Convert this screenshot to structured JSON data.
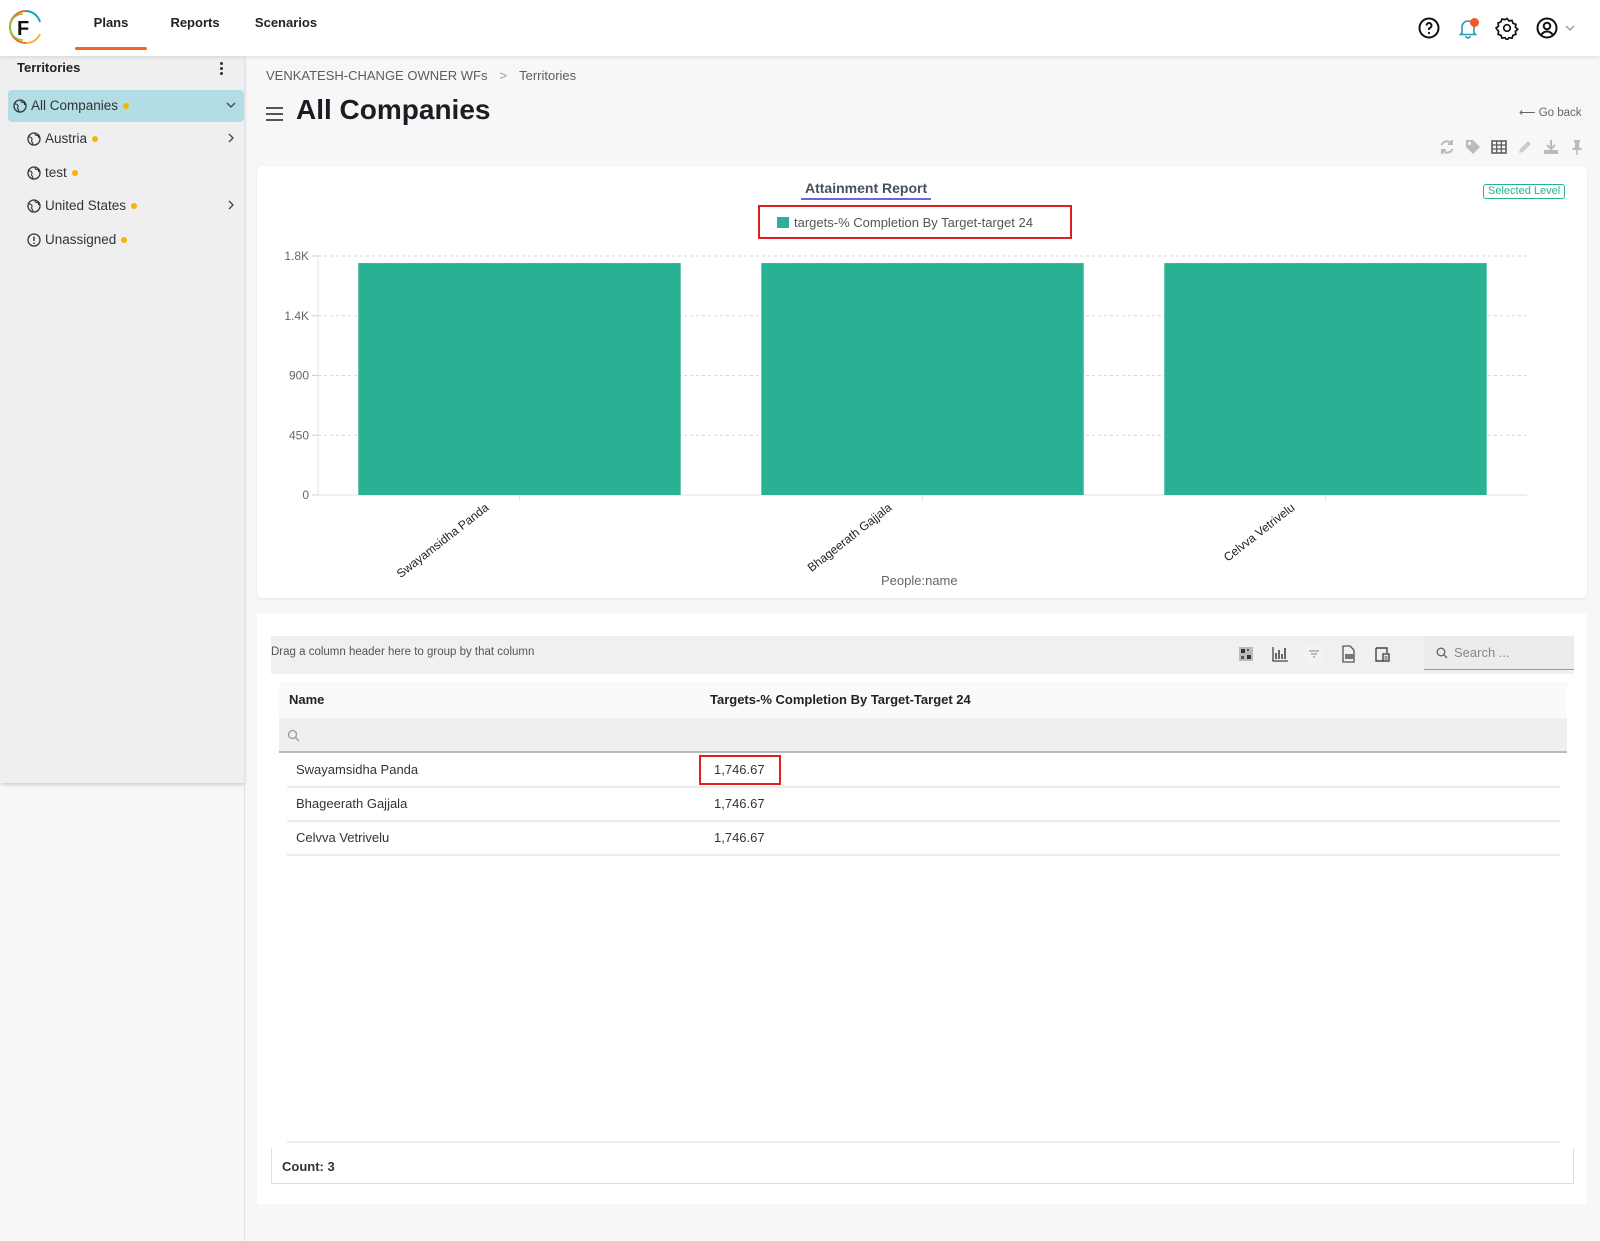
{
  "nav": {
    "tabs": [
      {
        "label": "Plans",
        "active": true
      },
      {
        "label": "Reports",
        "active": false
      },
      {
        "label": "Scenarios",
        "active": false
      }
    ],
    "icons": [
      "help-icon",
      "bell-icon",
      "gear-icon",
      "user-icon"
    ],
    "accent": "#f26522"
  },
  "sidebar": {
    "title": "Territories",
    "items": [
      {
        "label": "All Companies",
        "icon": "globe-icon",
        "selected": true,
        "expand": "down"
      },
      {
        "label": "Austria",
        "icon": "globe-icon",
        "selected": false,
        "expand": "right"
      },
      {
        "label": "test",
        "icon": "globe-icon",
        "selected": false,
        "expand": ""
      },
      {
        "label": "United States",
        "icon": "globe-icon",
        "selected": false,
        "expand": "right"
      },
      {
        "label": "Unassigned",
        "icon": "alert-circle-icon",
        "selected": false,
        "expand": ""
      }
    ]
  },
  "breadcrumb": {
    "items": [
      "VENKATESH-CHANGE OWNER WFs",
      "Territories"
    ]
  },
  "page": {
    "title": "All Companies",
    "go_back": "Go back"
  },
  "report": {
    "selected_level": "Selected Level",
    "toolbar_icons": [
      "refresh-icon",
      "tag-icon",
      "table-icon",
      "edit-icon",
      "download-icon",
      "pin-icon"
    ]
  },
  "chart_data": {
    "type": "bar",
    "title": "Attainment Report",
    "legend": [
      "targets-% Completion By Target-target 24"
    ],
    "legend_position": "top-center",
    "categories": [
      "Swayamsidha Panda",
      "Bhageerath Gajjala",
      "Celvva Vetrivelu"
    ],
    "series": [
      {
        "name": "targets-% Completion By Target-target 24",
        "values": [
          1746.67,
          1746.67,
          1746.67
        ],
        "color": "#28b192"
      }
    ],
    "xlabel": "People:name",
    "ylabel": "",
    "yticks": [
      0,
      450,
      900,
      1350,
      1800
    ],
    "ytick_labels": [
      "0",
      "450",
      "900",
      "1.4K",
      "1.8K"
    ],
    "ylim": [
      0,
      1800
    ],
    "grid": true
  },
  "grid": {
    "group_hint": "Drag a column header here to group by that column",
    "search_placeholder": "Search ...",
    "tool_icons": [
      "qr-icon",
      "chart-icon",
      "filter-icon",
      "export-pdf-icon",
      "column-chooser-icon"
    ],
    "columns": [
      "Name",
      "Targets-% Completion By Target-Target 24"
    ],
    "rows": [
      {
        "name": "Swayamsidha Panda",
        "value": "1,746.67"
      },
      {
        "name": "Bhageerath Gajjala",
        "value": "1,746.67"
      },
      {
        "name": "Celvva Vetrivelu",
        "value": "1,746.67"
      }
    ],
    "count_label": "Count: 3"
  }
}
